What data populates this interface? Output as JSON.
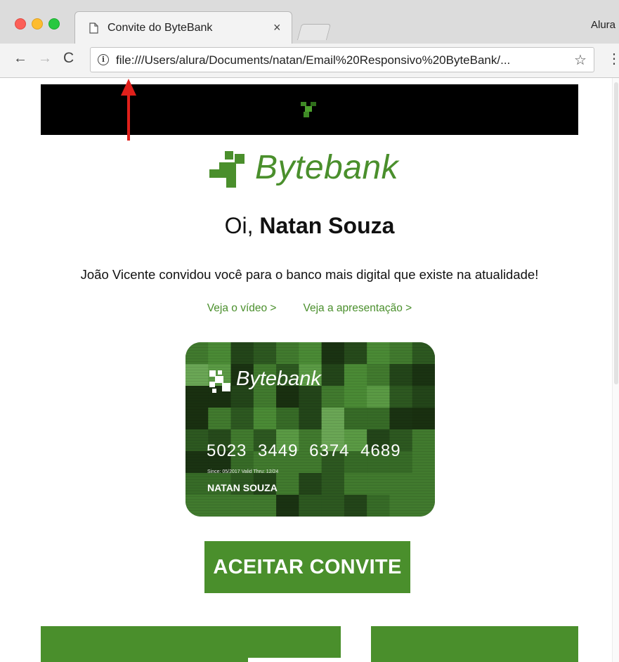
{
  "browser": {
    "tab_title": "Convite do ByteBank",
    "tab_close": "×",
    "profile_name": "Alura",
    "url": "file:///Users/alura/Documents/natan/Email%20Responsivo%20ByteBank/...",
    "nav": {
      "back": "←",
      "forward": "→",
      "reload": "C",
      "star": "☆",
      "menu": "⋮",
      "info": "i"
    }
  },
  "email": {
    "brand_name": "Bytebank",
    "greeting_prefix": "Oi,",
    "greeting_name": "Natan Souza",
    "invite_text": "João Vicente convidou você para o banco mais digital que existe na atualidade!",
    "links": [
      "Veja o vídeo >",
      "Veja a apresentação >"
    ],
    "card": {
      "brand": "Bytebank",
      "number": "5023  3449  6374  4689",
      "meta": "Since: 05/2017  Valid Thru: 12/24",
      "holder": "NATAN SOUZA"
    },
    "cta_label": "ACEITAR CONVITE"
  },
  "colors": {
    "brand_green": "#4a8f2c",
    "banner_black": "#000000",
    "annotation_red": "#e0201b"
  }
}
